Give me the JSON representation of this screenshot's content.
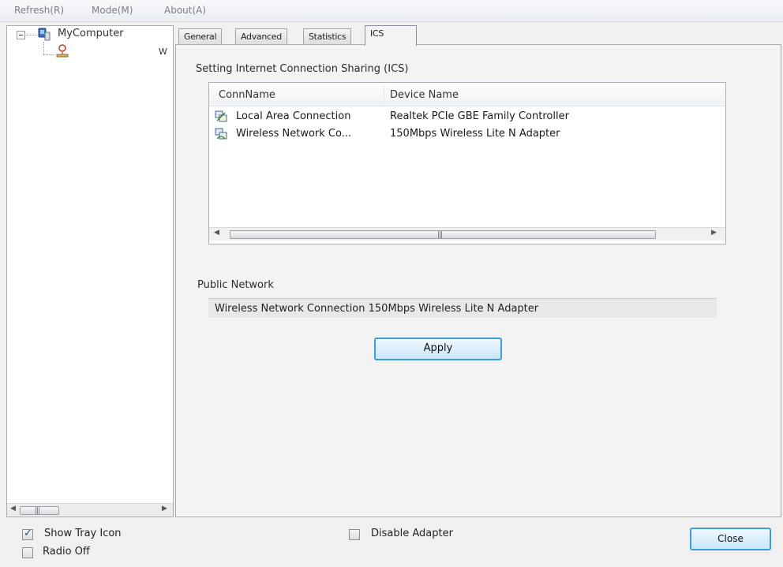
{
  "menu": {
    "refresh": "Refresh(R)",
    "mode": "Mode(M)",
    "about": "About(A)"
  },
  "tree": {
    "root_label": "MyComputer",
    "adapter_label": "W"
  },
  "tabs": [
    {
      "label": "General",
      "active": false
    },
    {
      "label": "Advanced",
      "active": false
    },
    {
      "label": "Statistics",
      "active": false
    },
    {
      "label": "ICS",
      "active": true
    }
  ],
  "ics": {
    "heading": "Setting Internet Connection Sharing (ICS)",
    "columns": [
      "ConnName",
      "Device Name"
    ],
    "rows": [
      {
        "conn_name": "Local Area Connection",
        "device_name": "Realtek PCIe GBE Family Controller",
        "icon": "network-connection-icon"
      },
      {
        "conn_name": "Wireless Network Co...",
        "device_name": "150Mbps Wireless Lite N Adapter",
        "icon": "wireless-connection-icon"
      }
    ],
    "public_network_label": "Public Network",
    "public_network_value": "Wireless Network Connection  150Mbps Wireless Lite N Adapter",
    "apply_label": "Apply"
  },
  "footer": {
    "show_tray_icon_label": "Show Tray Icon",
    "show_tray_icon_checked": true,
    "radio_off_label": "Radio Off",
    "radio_off_checked": false,
    "disable_adapter_label": "Disable Adapter",
    "disable_adapter_checked": false,
    "close_label": "Close"
  },
  "colors": {
    "accent_button_border": "#3c9fd8",
    "window_background": "#f0f0f0",
    "checkmark": "#1b4f8c"
  }
}
